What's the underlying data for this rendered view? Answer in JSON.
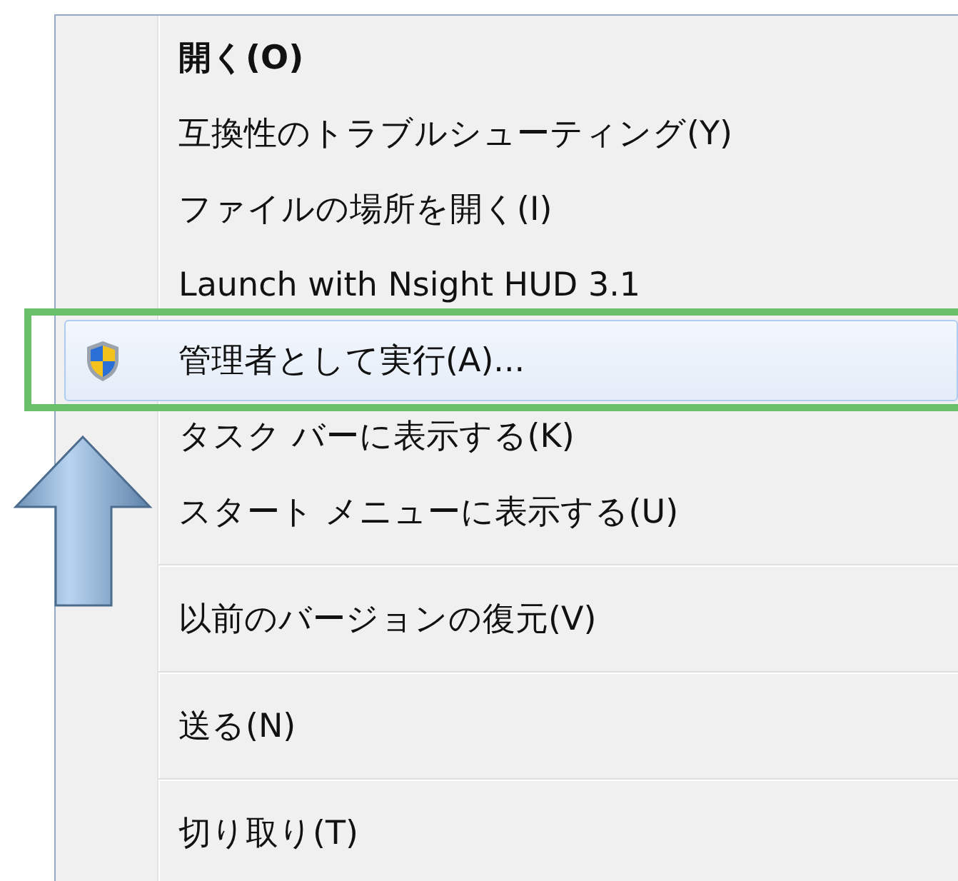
{
  "context_menu": {
    "items": [
      {
        "kind": "item",
        "label": "開く(O)",
        "bold": true,
        "selected": false,
        "shield": false
      },
      {
        "kind": "item",
        "label": "互換性のトラブルシューティング(Y)",
        "bold": false,
        "selected": false,
        "shield": false
      },
      {
        "kind": "item",
        "label": "ファイルの場所を開く(I)",
        "bold": false,
        "selected": false,
        "shield": false
      },
      {
        "kind": "item",
        "label": "Launch with Nsight HUD 3.1",
        "bold": false,
        "selected": false,
        "shield": false
      },
      {
        "kind": "item",
        "label": "管理者として実行(A)...",
        "bold": false,
        "selected": true,
        "shield": true
      },
      {
        "kind": "item",
        "label": "タスク バーに表示する(K)",
        "bold": false,
        "selected": false,
        "shield": false
      },
      {
        "kind": "item",
        "label": "スタート メニューに表示する(U)",
        "bold": false,
        "selected": false,
        "shield": false
      },
      {
        "kind": "separator"
      },
      {
        "kind": "item",
        "label": "以前のバージョンの復元(V)",
        "bold": false,
        "selected": false,
        "shield": false
      },
      {
        "kind": "separator"
      },
      {
        "kind": "item",
        "label": "送る(N)",
        "bold": false,
        "selected": false,
        "shield": false
      },
      {
        "kind": "separator"
      },
      {
        "kind": "item",
        "label": "切り取り(T)",
        "bold": false,
        "selected": false,
        "shield": false
      }
    ]
  }
}
